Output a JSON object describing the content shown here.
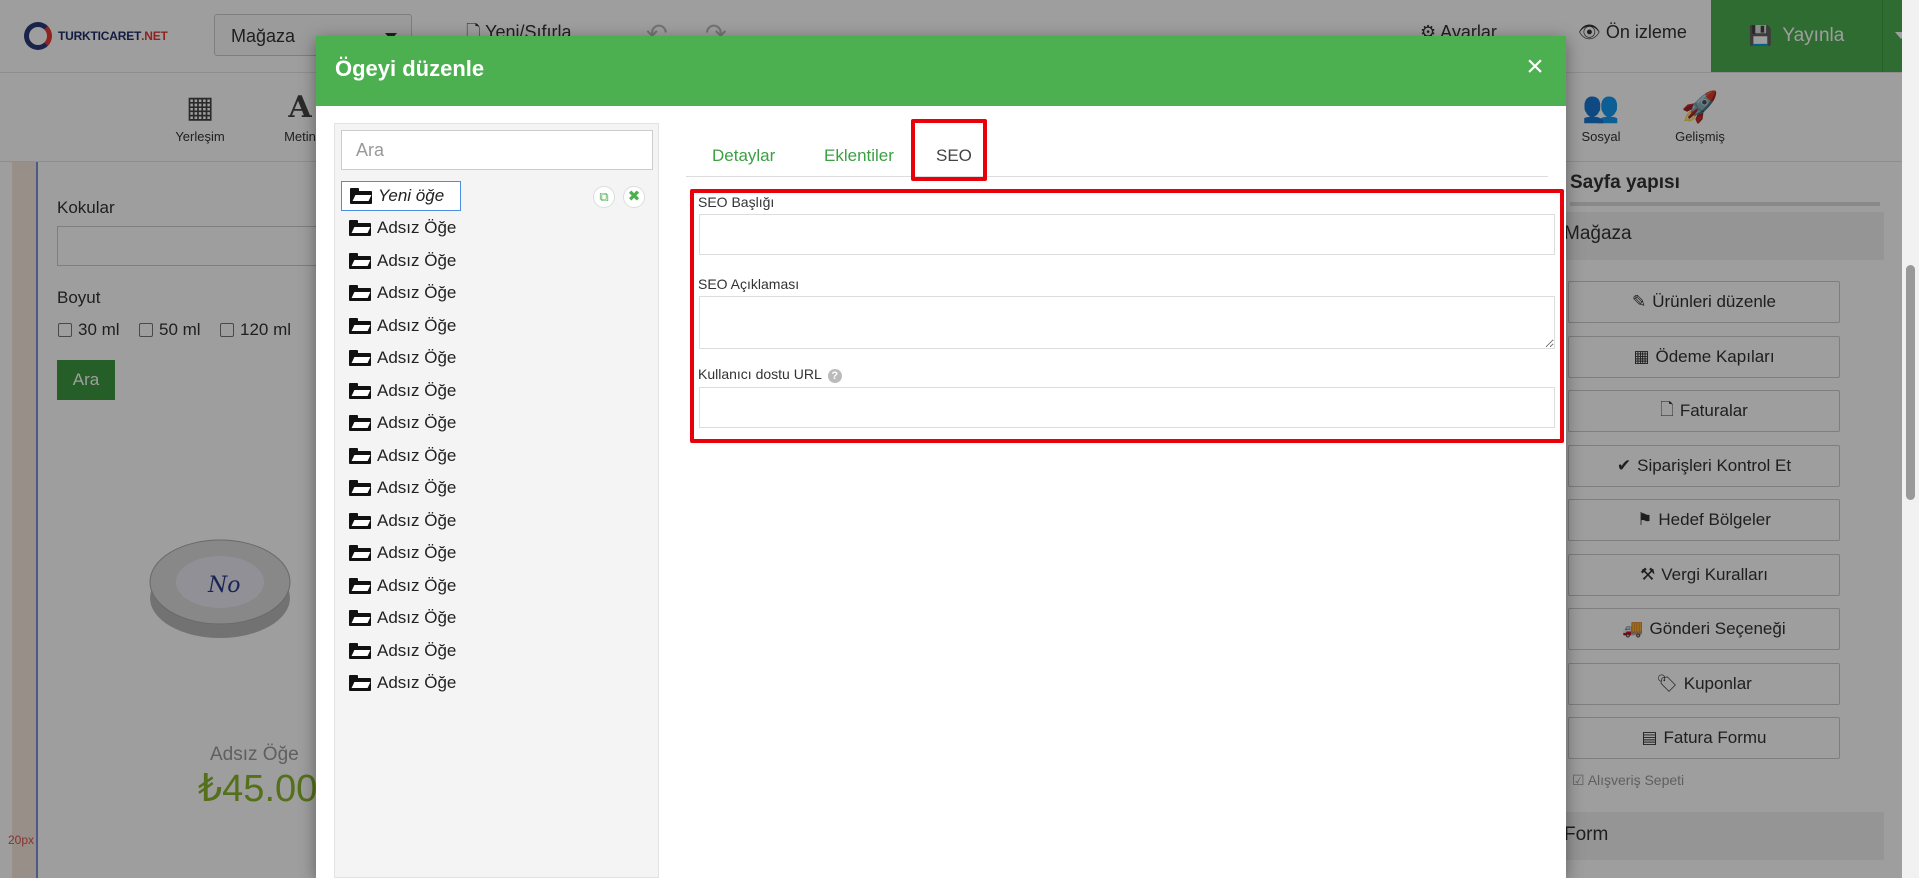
{
  "app": {
    "logo_text": "TURKTICARET",
    "logo_suffix": ".NET",
    "store_selector": "Mağaza",
    "new_reset": "Yeni/Sıfırla",
    "settings": "Ayarlar",
    "preview": "Ön izleme",
    "publish": "Yayınla"
  },
  "toolbar": {
    "items": [
      {
        "label": "Yerleşim",
        "icon": "layout-icon"
      },
      {
        "label": "Metin",
        "icon": "text-icon"
      },
      {
        "label": "Sosyal",
        "icon": "social-icon"
      },
      {
        "label": "Gelişmiş",
        "icon": "rocket-icon"
      }
    ]
  },
  "canvas": {
    "kokular_label": "Kokular",
    "boyut_label": "Boyut",
    "sizes": [
      "30 ml",
      "50 ml",
      "120 ml"
    ],
    "search_button": "Ara",
    "product_name": "Adsız Öğe",
    "product_price": "₺45.00",
    "spacing_label": "20px"
  },
  "right_panel": {
    "title": "Sayfa yapısı",
    "section": "Mağaza",
    "buttons": [
      {
        "label": "Ürünleri düzenle",
        "icon": "pencil-icon"
      },
      {
        "label": "Ödeme Kapıları",
        "icon": "grid-icon"
      },
      {
        "label": "Faturalar",
        "icon": "file-icon"
      },
      {
        "label": "Siparişleri Kontrol Et",
        "icon": "check-icon"
      },
      {
        "label": "Hedef Bölgeler",
        "icon": "signpost-icon"
      },
      {
        "label": "Vergi Kuralları",
        "icon": "gavel-icon"
      },
      {
        "label": "Gönderi Seçeneği",
        "icon": "truck-icon"
      },
      {
        "label": "Kuponlar",
        "icon": "tags-icon"
      },
      {
        "label": "Fatura Formu",
        "icon": "list-alt-icon"
      }
    ],
    "cart_option": "Alışveriş Sepeti",
    "form_section": "Form"
  },
  "modal": {
    "title": "Ögeyi düzenle",
    "close": "×",
    "search_placeholder": "Ara",
    "tree_items": [
      "Yeni öğe",
      "Adsız Öğe",
      "Adsız Öğe",
      "Adsız Öğe",
      "Adsız Öğe",
      "Adsız Öğe",
      "Adsız Öğe",
      "Adsız Öğe",
      "Adsız Öğe",
      "Adsız Öğe",
      "Adsız Öğe",
      "Adsız Öğe",
      "Adsız Öğe",
      "Adsız Öğe",
      "Adsız Öğe",
      "Adsız Öğe"
    ],
    "tabs": [
      "Detaylar",
      "Eklentiler",
      "SEO"
    ],
    "active_tab": "SEO",
    "seo": {
      "title_label": "SEO Başlığı",
      "title_value": "",
      "description_label": "SEO Açıklaması",
      "description_value": "",
      "url_label": "Kullanıcı dostu URL",
      "url_value": ""
    }
  },
  "colors": {
    "accent": "#4caf50",
    "highlight": "#e8000b",
    "price": "#8ab52a"
  }
}
